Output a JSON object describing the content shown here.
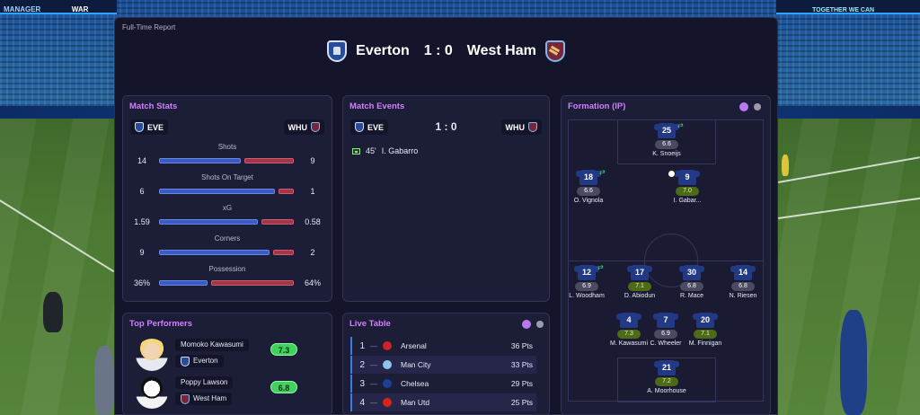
{
  "panel": {
    "label": "Full-Time Report"
  },
  "match": {
    "home_team": "Everton",
    "away_team": "West Ham",
    "score": "1 : 0",
    "home_short": "EVE",
    "away_short": "WHU"
  },
  "stadium_ads": {
    "left_board": "MANAGER",
    "left_board2": "WAR",
    "right_board": "TOGETHER WE CAN"
  },
  "match_stats": {
    "title": "Match Stats",
    "rows": [
      {
        "label": "Shots",
        "home": "14",
        "away": "9",
        "home_frac": 0.609,
        "away_frac": 0.391
      },
      {
        "label": "Shots On Target",
        "home": "6",
        "away": "1",
        "home_frac": 0.857,
        "away_frac": 0.143
      },
      {
        "label": "xG",
        "home": "1.59",
        "away": "0.58",
        "home_frac": 0.733,
        "away_frac": 0.267
      },
      {
        "label": "Corners",
        "home": "9",
        "away": "2",
        "home_frac": 0.818,
        "away_frac": 0.182
      },
      {
        "label": "Possession",
        "home": "36%",
        "away": "64%",
        "home_frac": 0.36,
        "away_frac": 0.64
      }
    ]
  },
  "match_events": {
    "title": "Match Events",
    "score": "1 : 0",
    "events": [
      {
        "minute": "45'",
        "player": "I. Gabarro",
        "type": "goal-icon"
      }
    ]
  },
  "formation": {
    "title": "Formation (IP)",
    "players": [
      {
        "number": "25",
        "rating": "6.6",
        "name": "K. Snoeijs",
        "rating_color": "grey",
        "sub": true,
        "goal": false
      },
      {
        "number": "18",
        "rating": "6.6",
        "name": "O. Vignola",
        "rating_color": "grey",
        "sub": true,
        "goal": false
      },
      {
        "number": "9",
        "rating": "7.0",
        "name": "I. Gabar...",
        "rating_color": "green",
        "sub": false,
        "goal": true
      },
      {
        "number": "12",
        "rating": "6.9",
        "name": "L. Woodham",
        "rating_color": "grey",
        "sub": true,
        "goal": false
      },
      {
        "number": "17",
        "rating": "7.1",
        "name": "D. Abiodun",
        "rating_color": "green",
        "sub": false,
        "goal": false
      },
      {
        "number": "30",
        "rating": "6.8",
        "name": "R. Mace",
        "rating_color": "grey",
        "sub": false,
        "goal": false
      },
      {
        "number": "14",
        "rating": "6.8",
        "name": "N. Riesen",
        "rating_color": "grey",
        "sub": false,
        "goal": false
      },
      {
        "number": "4",
        "rating": "7.3",
        "name": "M. Kawasumi",
        "rating_color": "green",
        "sub": false,
        "goal": false
      },
      {
        "number": "7",
        "rating": "6.9",
        "name": "C. Wheeler",
        "rating_color": "grey",
        "sub": false,
        "goal": false
      },
      {
        "number": "20",
        "rating": "7.1",
        "name": "M. Finnigan",
        "rating_color": "green",
        "sub": false,
        "goal": false
      },
      {
        "number": "21",
        "rating": "7.2",
        "name": "A. Moorhouse",
        "rating_color": "green",
        "sub": false,
        "goal": false
      }
    ]
  },
  "top_performers": {
    "title": "Top Performers",
    "players": [
      {
        "name": "Momoko Kawasumi",
        "team": "Everton",
        "rating": "7.3"
      },
      {
        "name": "Poppy Lawson",
        "team": "West Ham",
        "rating": "6.8"
      }
    ]
  },
  "live_table": {
    "title": "Live Table",
    "rows": [
      {
        "pos": "1",
        "trend": "—",
        "club": "Arsenal",
        "pts": "36 Pts",
        "color": "#d0202a"
      },
      {
        "pos": "2",
        "trend": "—",
        "club": "Man City",
        "pts": "33 Pts",
        "color": "#8ec5ea"
      },
      {
        "pos": "3",
        "trend": "—",
        "club": "Chelsea",
        "pts": "29 Pts",
        "color": "#1d3f9a"
      },
      {
        "pos": "4",
        "trend": "—",
        "club": "Man Utd",
        "pts": "25 Pts",
        "color": "#d8251c"
      }
    ]
  },
  "colors": {
    "accent": "#d080ff",
    "home_bar": "#3a5bc4",
    "away_bar": "#a03748",
    "rating_green": "#3fd35e"
  }
}
